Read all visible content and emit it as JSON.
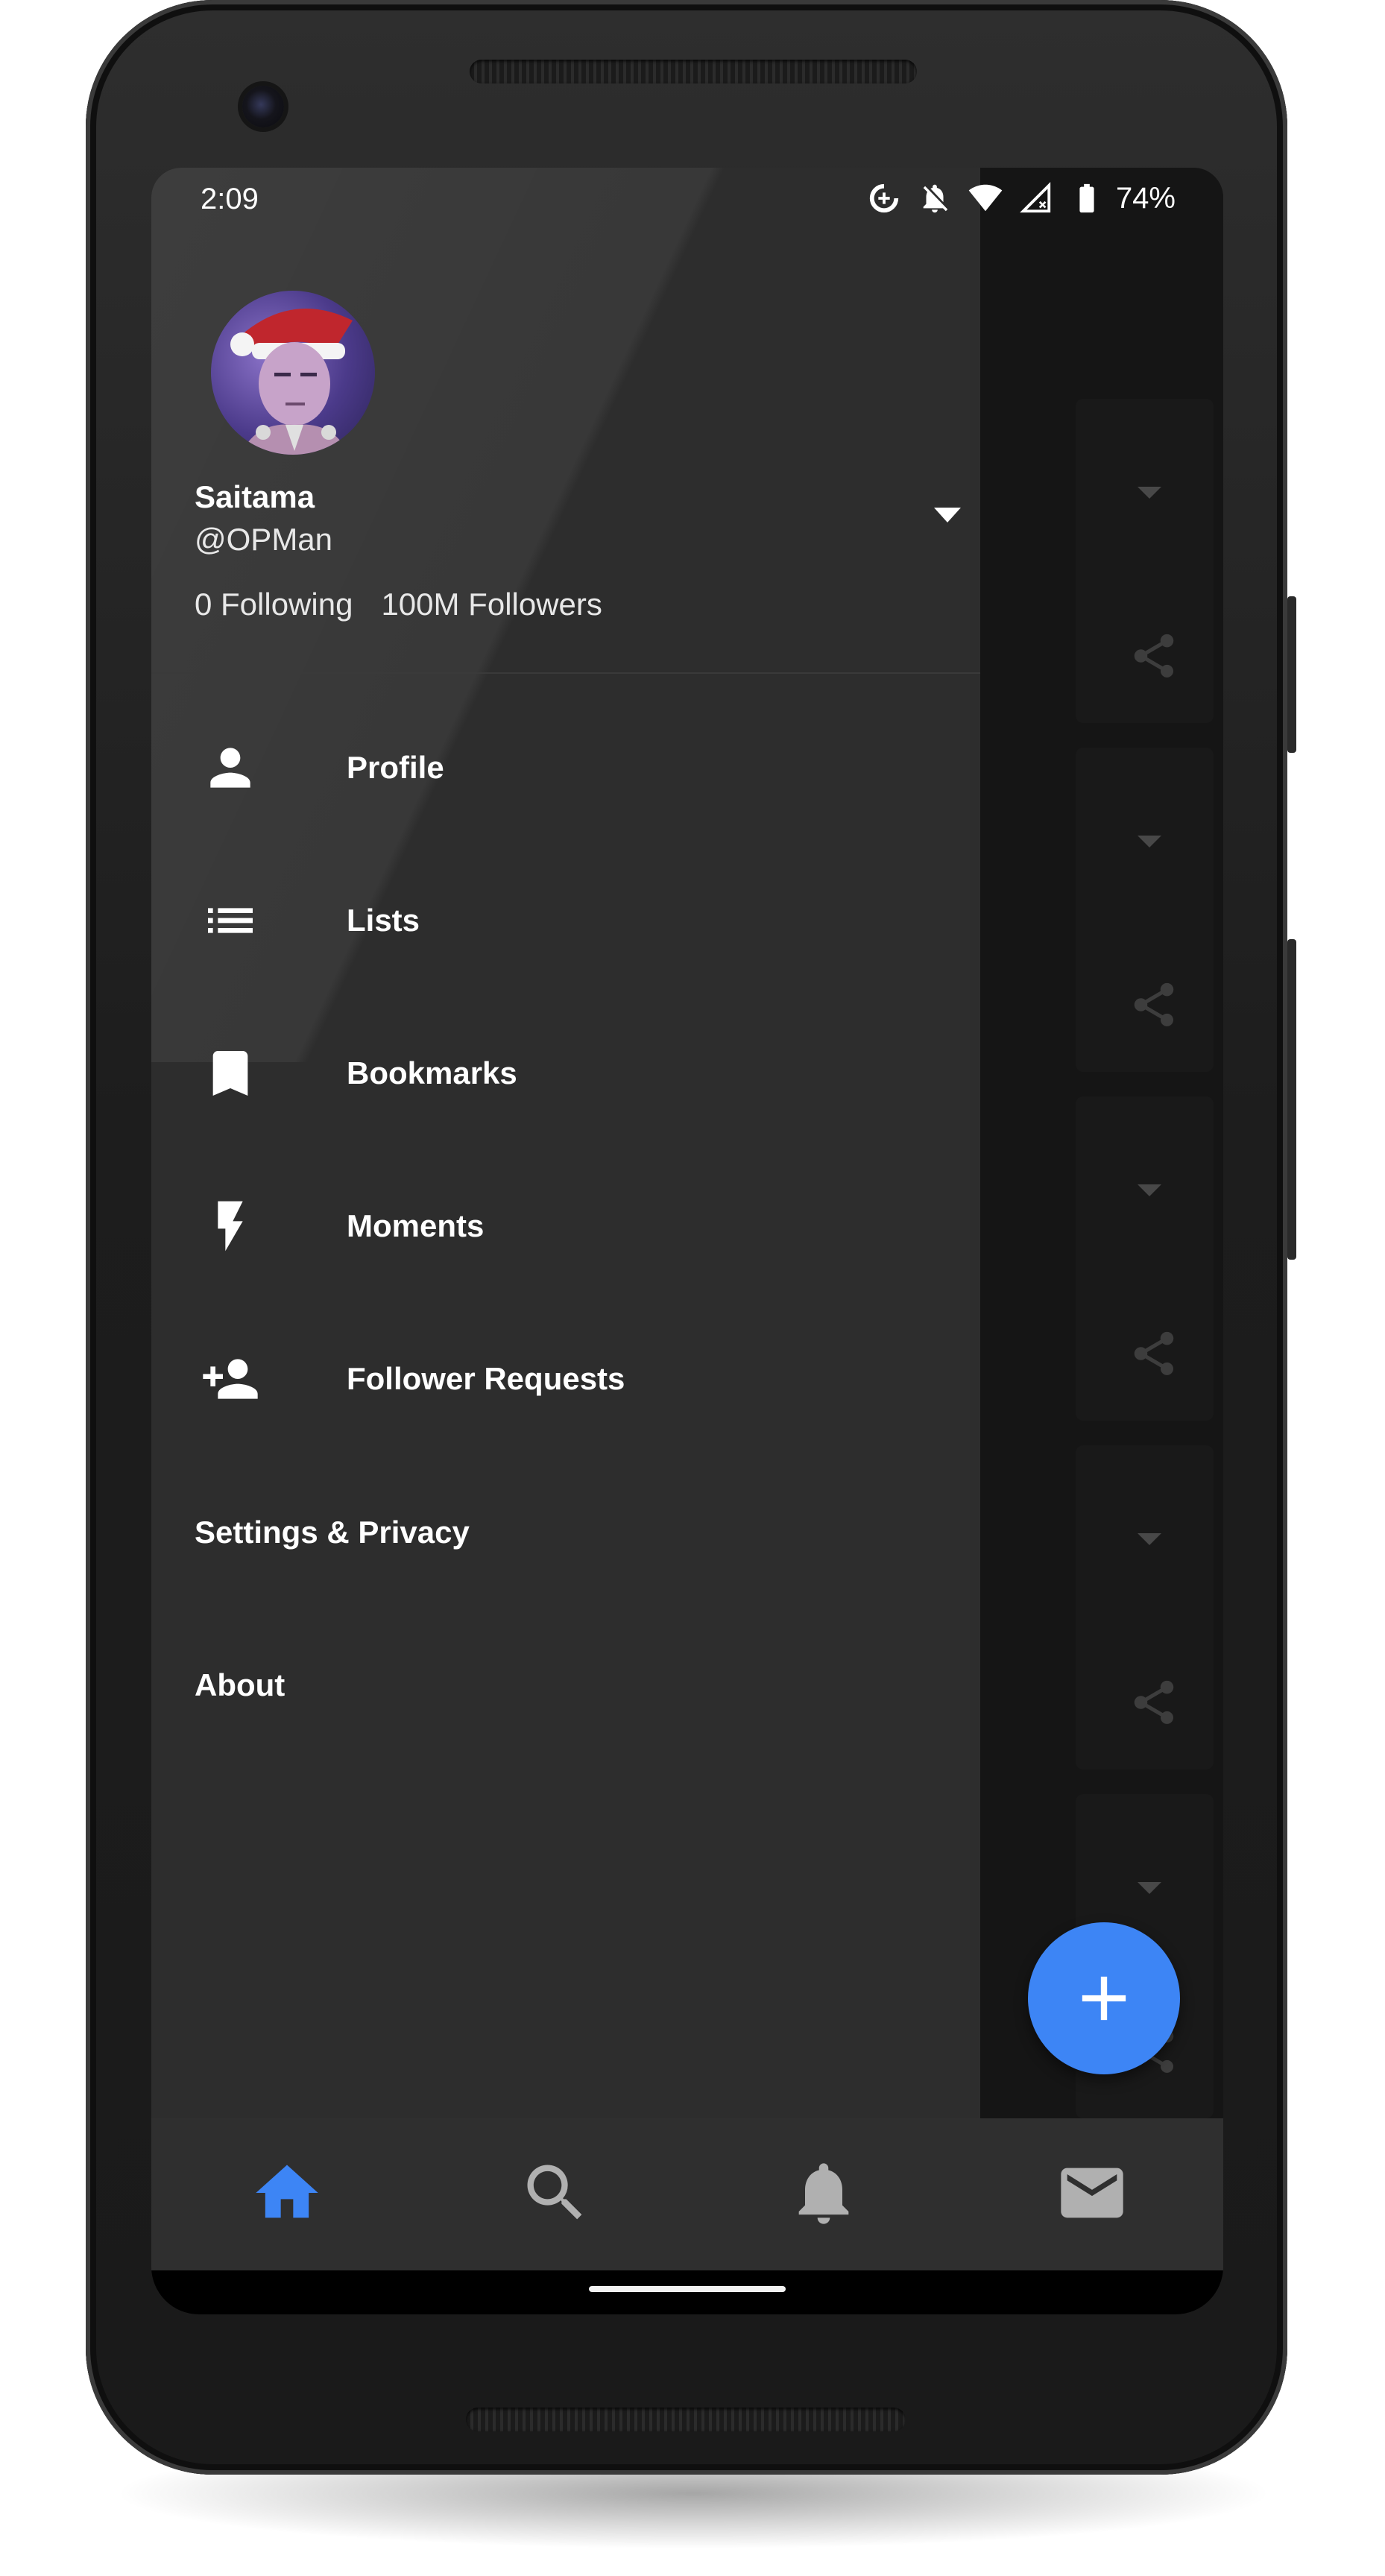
{
  "status_bar": {
    "time": "2:09",
    "battery_percent": "74%",
    "icons": [
      "data-saver-icon",
      "notifications-off-icon",
      "wifi-icon",
      "no-signal-icon",
      "battery-icon"
    ]
  },
  "drawer": {
    "account": {
      "name": "Saitama",
      "handle": "@OPMan",
      "following": "0 Following",
      "followers": "100M Followers"
    },
    "menu": [
      {
        "label": "Profile",
        "icon": "person-icon"
      },
      {
        "label": "Lists",
        "icon": "list-icon"
      },
      {
        "label": "Bookmarks",
        "icon": "bookmark-icon"
      },
      {
        "label": "Moments",
        "icon": "bolt-icon"
      },
      {
        "label": "Follower Requests",
        "icon": "person-add-icon"
      }
    ],
    "settings_label": "Settings & Privacy",
    "about_label": "About"
  },
  "bottom_nav": {
    "items": [
      {
        "icon": "home-icon",
        "active": true
      },
      {
        "icon": "search-icon",
        "active": false
      },
      {
        "icon": "bell-icon",
        "active": false
      },
      {
        "icon": "mail-icon",
        "active": false
      }
    ]
  },
  "fab": {
    "icon": "add-icon"
  },
  "colors": {
    "accent": "#3d85f5",
    "drawer_bg": "#2d2d2d",
    "nav_bg": "#2f2f2f"
  }
}
